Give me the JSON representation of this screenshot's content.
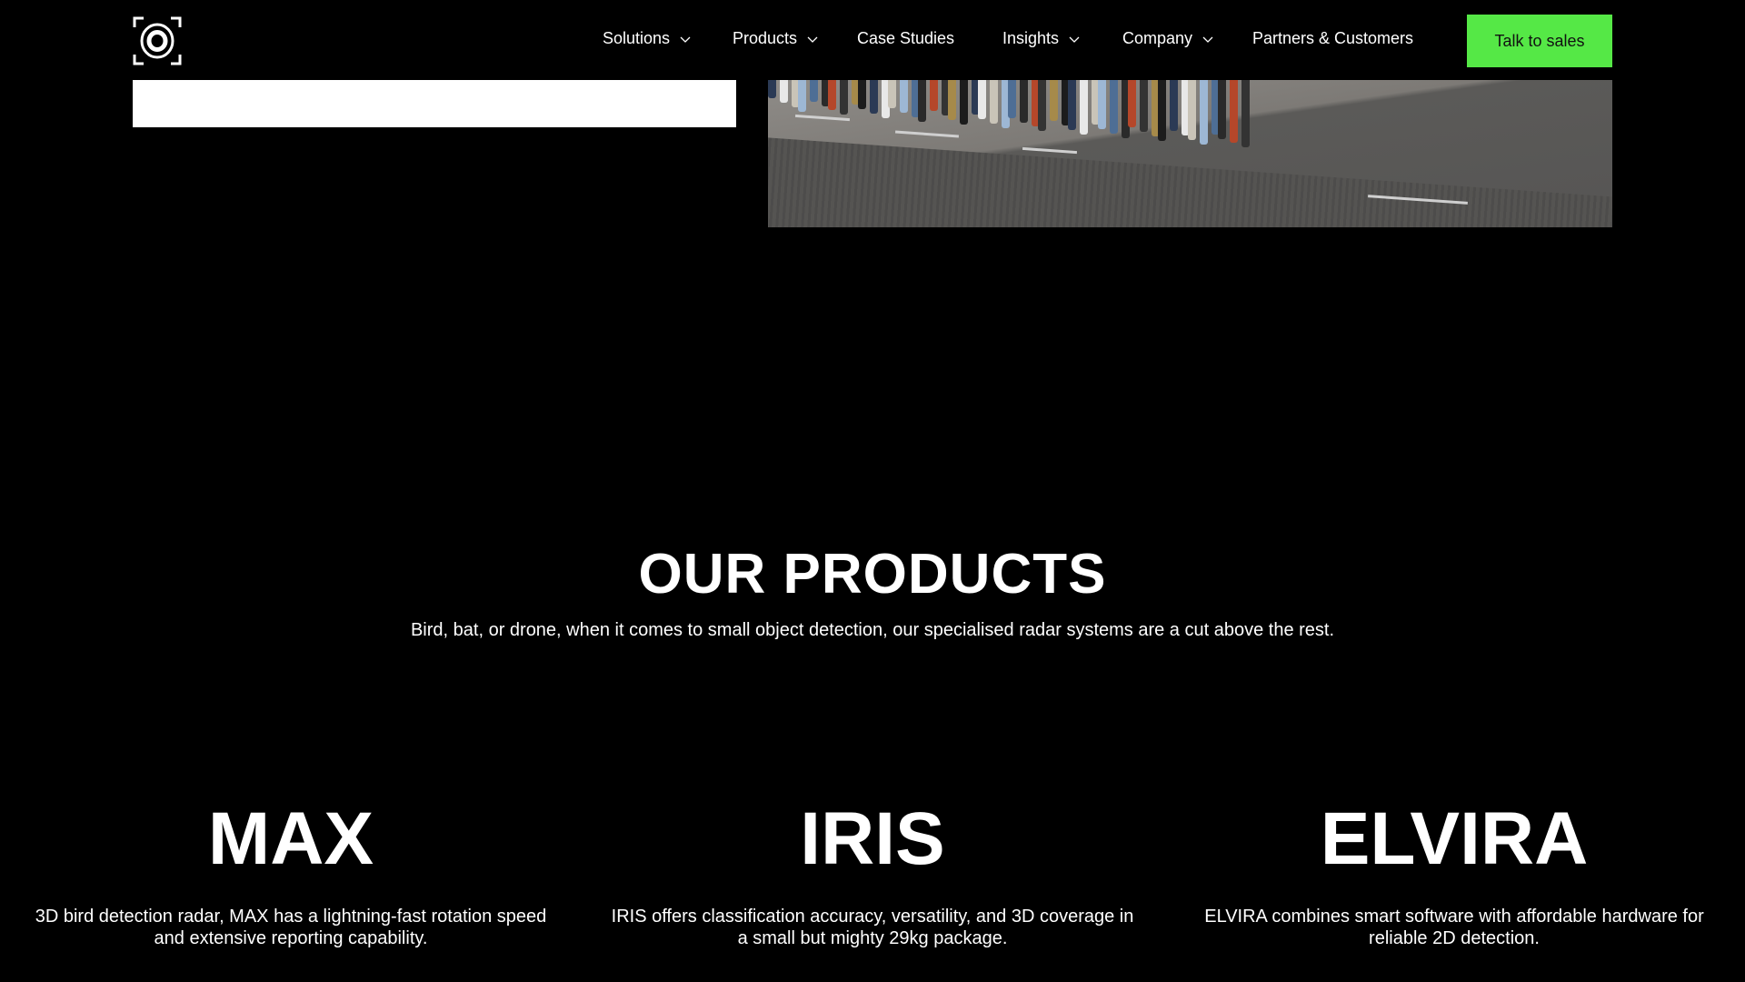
{
  "nav": {
    "items": [
      {
        "label": "Solutions",
        "dropdown": true
      },
      {
        "label": "Products",
        "dropdown": true
      },
      {
        "label": "Case Studies",
        "dropdown": false
      },
      {
        "label": "Insights",
        "dropdown": true
      },
      {
        "label": "Company",
        "dropdown": true
      },
      {
        "label": "Partners & Customers",
        "dropdown": false
      }
    ],
    "cta_label": "Talk to sales",
    "cta_color": "#55e846"
  },
  "products_section": {
    "title": "OUR PRODUCTS",
    "subtitle": "Bird, bat, or drone, when it comes to small object detection, our specialised radar systems are a cut above the rest.",
    "products": [
      {
        "name": "MAX",
        "description": "3D bird detection radar, MAX has a lightning-fast rotation speed and extensive reporting capability."
      },
      {
        "name": "IRIS",
        "description": "IRIS offers classification accuracy, versatility, and 3D coverage in a small but mighty 29kg package."
      },
      {
        "name": "ELVIRA",
        "description": "ELVIRA combines smart software with affordable hardware for reliable 2D detection."
      }
    ]
  }
}
